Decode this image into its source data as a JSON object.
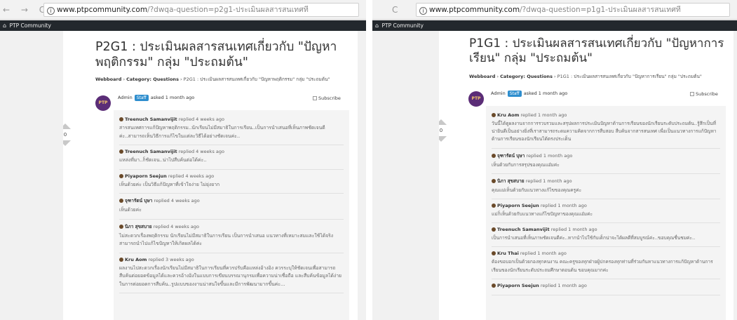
{
  "left": {
    "browser": {
      "nav": "← → C",
      "url_host": "www.ptpcommunity.com",
      "url_path": "/?dwqa-question=p2g1-ประเมินผลสารสนเทศที"
    },
    "site_name": "PTP Community",
    "question": {
      "title": "P2G1 : ประเมินผลสารสนเทศเกี่ยวกับ \"ปัญหาพฤติกรรม\" กลุ่ม \"ประถมต้น\"",
      "breadcrumb": {
        "home": "Webboard",
        "sep": " › ",
        "category": "Category: Questions",
        "current": "P2G1 : ประเมินผลสารสนเทศเกี่ยวกับ \"ปัญหาพฤติกรรม\" กลุ่ม \"ประถมต้น\""
      },
      "author": "Admin",
      "badge": "Staff",
      "asked": "asked 1 month ago",
      "subscribe": "Subscribe",
      "avatar_text": "PTP",
      "votes": "0"
    },
    "comments": [
      {
        "author": "Treenuch Samanvijit",
        "when": "replied 4 weeks ago",
        "text": "สารสนเทศการแก้ปัญหาพฤติกรรม..นักเรียนไม่มีสมาธิในการเรียน..เป็นการนำเสนอที่เห็นภาพชัดเจนดีค่ะ..สามารถเห็นวิธีการแก้ไขในแต่ละวิธีได้อย่างชัดเจนค่ะ.."
      },
      {
        "author": "Treenuch Samanvijit",
        "when": "replied 4 weeks ago",
        "text": "แหล่งที่มา..ก็ชัดเจน..น่าไปสืบค้นต่อได้ค่ะ.."
      },
      {
        "author": "Piyaporn Seejun",
        "when": "replied 4 weeks ago",
        "text": "เห็นด้วยค่ะ เป็นวิธีแก้ปัญหาที่เข้าใจง่าย ไม่ยุ่งยาก"
      },
      {
        "author": "จุฑารัตน์ บุษา",
        "when": "replied 4 weeks ago",
        "text": "เห็นด้วยค่ะ"
      },
      {
        "author": "นิภา สุขสบาย",
        "when": "replied 4 weeks ago",
        "text": "ไม่สะดวกเรื่องพฤติกรรม นักเรียนไม่มีสมาธิในการเรียน เป็นการนำเสนอ แนวทางที่เหมาะสมและใช้ได้จริง สามารถนำไปแก้ไขปัญหาให้เกิดผลได้ค่ะ"
      },
      {
        "author": "Kru Aom",
        "when": "replied 3 weeks ago",
        "text": "ผลงานไปสะดวกเรื่องนักเรียนไม่มีสมาธิในการเรียนที่ควรปรับคือแหล่งอ้างอิง ควรระบุให้ชัดเจนเพื่อสามารถสืบค้นต่อยอดข้อมูลได้และควรอ้างอิงในแบบการเขียนบรรณานุกรมเพื่อความน่าเชื่อถือ และสืบค้นข้อมูลได้ง่ายในการต่อยอดการสืบค้น..รูปแบบของงานน่าสนใจขึ้นและมีการพัฒนามากขึ้นค่ะ..."
      }
    ]
  },
  "right": {
    "browser": {
      "nav": "C",
      "url_host": "www.ptpcommunity.com",
      "url_path": "/?dwqa-question=p1g1-ประเมินผลสารสนเทศที"
    },
    "site_name": "PTP Community",
    "question": {
      "title": "P1G1 : ประเมินผลสารสนเทศเกี่ยวกับ \"ปัญหาการเรียน\" กลุ่ม \"ประถมต้น\"",
      "breadcrumb": {
        "home": "Webboard",
        "sep": " › ",
        "category": "Category: Questions",
        "current": "P1G1 : ประเมินผลสารสนเทศเกี่ยวกับ \"ปัญหาการเรียน\" กลุ่ม \"ประถมต้น\""
      },
      "author": "Admin",
      "badge": "Staff",
      "asked": "asked 1 month ago",
      "subscribe": "Subscribe",
      "avatar_text": "PTP",
      "votes": "0"
    },
    "comments": [
      {
        "author": "Kru Aom",
        "when": "replied 1 month ago",
        "text": "วันนี้ได้ดูผลงานจากการรวบรวมและสรุปผลการประเมินปัญหาด้านการเรียนของนักเรียนระดับประถมต้น..รู้สึกเป็นที่น่ายินดีเป็นอย่างยิ่งที่เราสามารถระดมความคิดจากการสืบสอบ สืบค้นจากสารสนเทศ เพื่อเป็นแนวทางการแก้ปัญหาด้านการเรียนของนักเรียนได้ตรงประเด็น"
      },
      {
        "author": "จุฑารัตน์ บุษา",
        "when": "replied 1 month ago",
        "text": "เห็นด้วยกับการสรุปของคุณแอ๋มค่ะ"
      },
      {
        "author": "นิภา สุขสบาย",
        "when": "replied 1 month ago",
        "text": "คุณแม่เห็นด้วยกับแนวทางแก้ไขของคุณครูค่ะ"
      },
      {
        "author": "Piyaporn Seejun",
        "when": "replied 1 month ago",
        "text": "แม่ก็เห็นด้วยกับแนวทางแก้ไขปัญหาของคุณแอ๋มค่ะ"
      },
      {
        "author": "Treenuch Samanvijit",
        "when": "replied 1 month ago",
        "text": "เป็นการนำเสนอที่เห็นภาพชัดเจนดีค่ะ..หากนำไปใช้กับเด็กน่าจะได้ผลดีที่สมบูรณ์ค่ะ..ขอบคุณชื่นชมค่ะ.."
      },
      {
        "author": "Kru Thai",
        "when": "replied 1 month ago",
        "text": "ต้องขอบอกเป็นด้วยกองทุกคนงาน คณะครูของทุกฝ่ายผู้ปกครองทุกท่านที่ร่วมกันหาแนวทางการแก้ปัญหาด้านการเรียนของนักเรียนระดับประถมศึกษาตอนต้น ขอบคุณมากค่ะ"
      },
      {
        "author": "Piyaporn Seejun",
        "when": "replied 1 month ago",
        "text": ""
      }
    ]
  }
}
